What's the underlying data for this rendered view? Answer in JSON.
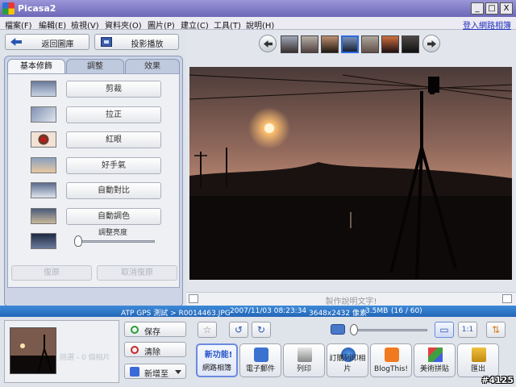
{
  "window": {
    "title": "Picasa2",
    "minimize": "_",
    "maximize": "□",
    "close": "X"
  },
  "menu": {
    "items": [
      "檔案(F)",
      "編輯(E)",
      "檢視(V)",
      "資料夾(O)",
      "圖片(P)",
      "建立(C)",
      "工具(T)",
      "說明(H)"
    ],
    "login": "登入網路相簿"
  },
  "left": {
    "back_label": "返回圖庫",
    "slideshow_label": "投影播放",
    "tabs": [
      "基本修飾",
      "調整",
      "效果"
    ],
    "tools": [
      "剪裁",
      "拉正",
      "紅眼",
      "好手氣",
      "自動對比",
      "自動調色"
    ],
    "slider_label": "調整亮度",
    "undo": "復原",
    "redo": "取消復原"
  },
  "viewer": {
    "caption_placeholder": "製作說明文字!"
  },
  "status": {
    "path": "ATP GPS 測試 > R0014463.JPG",
    "datetime": "2007/11/03 08:23:34",
    "dimensions": "3648x2432 像素",
    "size": "3.5MB",
    "position": "(16 / 60)"
  },
  "tray": {
    "ghost_text": "挑選 - 0 個相片"
  },
  "tray_buttons": {
    "hold": "保存",
    "clear": "清除",
    "add_to": "新增至"
  },
  "actions": {
    "new_badge": "新功能!",
    "items": [
      "網路相簿",
      "電子郵件",
      "列印",
      "訂購列印相片",
      "BlogThis!",
      "美術拼貼",
      "匯出"
    ]
  },
  "watermark": "#4125",
  "colors": {
    "accent": "#2366b8",
    "title_bar": "#6c68b8"
  }
}
